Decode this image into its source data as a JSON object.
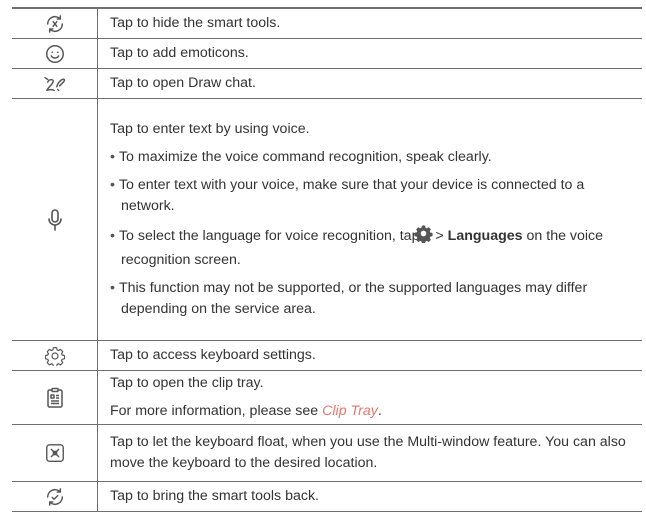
{
  "table": {
    "rows": [
      {
        "icon": "smart-tools-hide-icon",
        "text": "Tap to hide the smart tools."
      },
      {
        "icon": "emoticon-icon",
        "text": "Tap to add emoticons."
      },
      {
        "icon": "draw-chat-icon",
        "text": "Tap to open Draw chat."
      },
      {
        "icon": "microphone-icon",
        "text": "Tap to enter text by using voice.",
        "bullets": [
          "To maximize the voice command recognition, speak clearly.",
          "To enter text with your voice, make sure that your device is connected to a network.",
          "This function may not be supported, or the supported languages may differ depending on the service area."
        ],
        "language_bullet": {
          "before": "To select the language for voice recognition, tap",
          "separator": ">",
          "bold": "Languages",
          "after": "on the voice recognition screen."
        }
      },
      {
        "icon": "keyboard-settings-gear-icon",
        "text": "Tap to access keyboard settings."
      },
      {
        "icon": "clip-tray-icon",
        "text": "Tap to open the clip tray.",
        "more_info_prefix": "For more information, please see",
        "more_info_link": "Clip Tray",
        "more_info_suffix": "."
      },
      {
        "icon": "float-keyboard-icon",
        "text": "Tap to let the keyboard float, when you use the Multi-window feature. You can also move the keyboard to the desired location."
      },
      {
        "icon": "smart-tools-back-icon",
        "text": "Tap to bring the smart tools back."
      }
    ]
  },
  "colors": {
    "text": "#333333",
    "rule": "#6e6e6e",
    "link": "#e8766e",
    "icon": "#555555"
  }
}
